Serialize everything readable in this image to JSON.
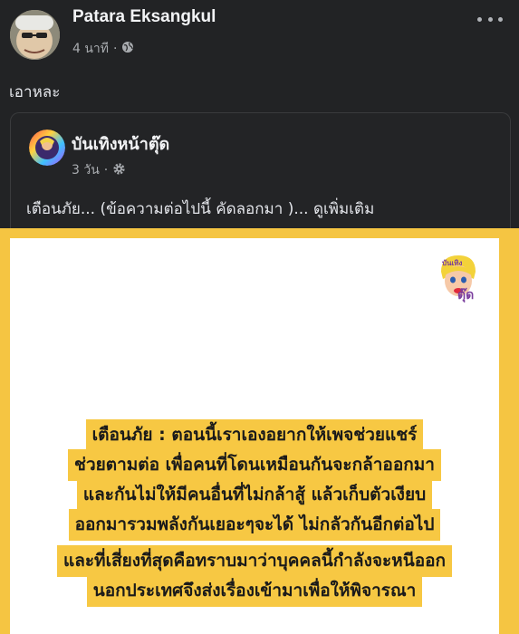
{
  "post": {
    "author": "Patara Eksangkul",
    "time": "4 นาที",
    "separator": "·",
    "text": "เอาหละ"
  },
  "shared": {
    "page_name": "บันเทิงหน้าตุ๊ด",
    "time": "3 วัน",
    "separator": "·",
    "text": "เตือนภัย... (ข้อความต่อไปนี้ คัดลอกมา )...",
    "see_more": "ดูเพิ่มเติม"
  },
  "image": {
    "logo_text": "ตุ๊ด",
    "block1": [
      "เตือนภัย : ตอนนี้เราเองอยากให้เพจช่วยแชร์",
      "ช่วยตามต่อ เพื่อคนที่โดนเหมือนกันจะกล้าออกมา",
      "และกันไม่ให้มีคนอื่นที่ไม่กล้าสู้ แล้วเก็บตัวเงียบ",
      "ออกมารวมพลังกันเยอะๆจะได้ ไม่กลัวกันอีกต่อไป"
    ],
    "block2": [
      "และที่เสี่ยงที่สุดคือทราบมาว่าบุคคลนี้กำลังจะหนีออก",
      "นอกประเทศจึงส่งเรื่องเข้ามาเพื่อให้พิจารณา"
    ]
  },
  "colors": {
    "background": "#222325",
    "highlight": "#f7c843",
    "frame": "#f5c542"
  },
  "icons": {
    "privacy": "globe-icon",
    "shared_privacy": "gear-icon",
    "menu": "more-horizontal-icon"
  }
}
